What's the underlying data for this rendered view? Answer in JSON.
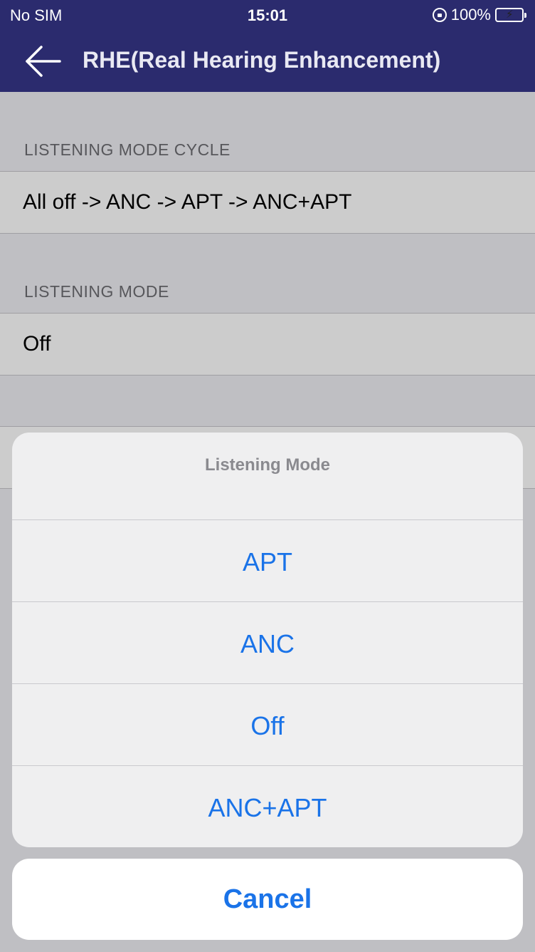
{
  "status_bar": {
    "carrier": "No SIM",
    "time": "15:01",
    "battery_percent": "100%",
    "battery_level": 1.0
  },
  "nav": {
    "title": "RHE(Real Hearing Enhancement)",
    "back_icon": "arrow-left-icon"
  },
  "sections": {
    "cycle": {
      "header": "LISTENING MODE CYCLE",
      "value": "All off -> ANC -> APT -> ANC+APT"
    },
    "mode": {
      "header": "LISTENING MODE",
      "value": "Off"
    }
  },
  "action_sheet": {
    "title": "Listening Mode",
    "options": [
      {
        "label": "APT"
      },
      {
        "label": "ANC"
      },
      {
        "label": "Off"
      },
      {
        "label": "ANC+APT"
      }
    ],
    "cancel_label": "Cancel"
  },
  "colors": {
    "nav_background": "#2b2b6e",
    "action_tint": "#1a73e8",
    "battery_fill": "#4cd964"
  }
}
